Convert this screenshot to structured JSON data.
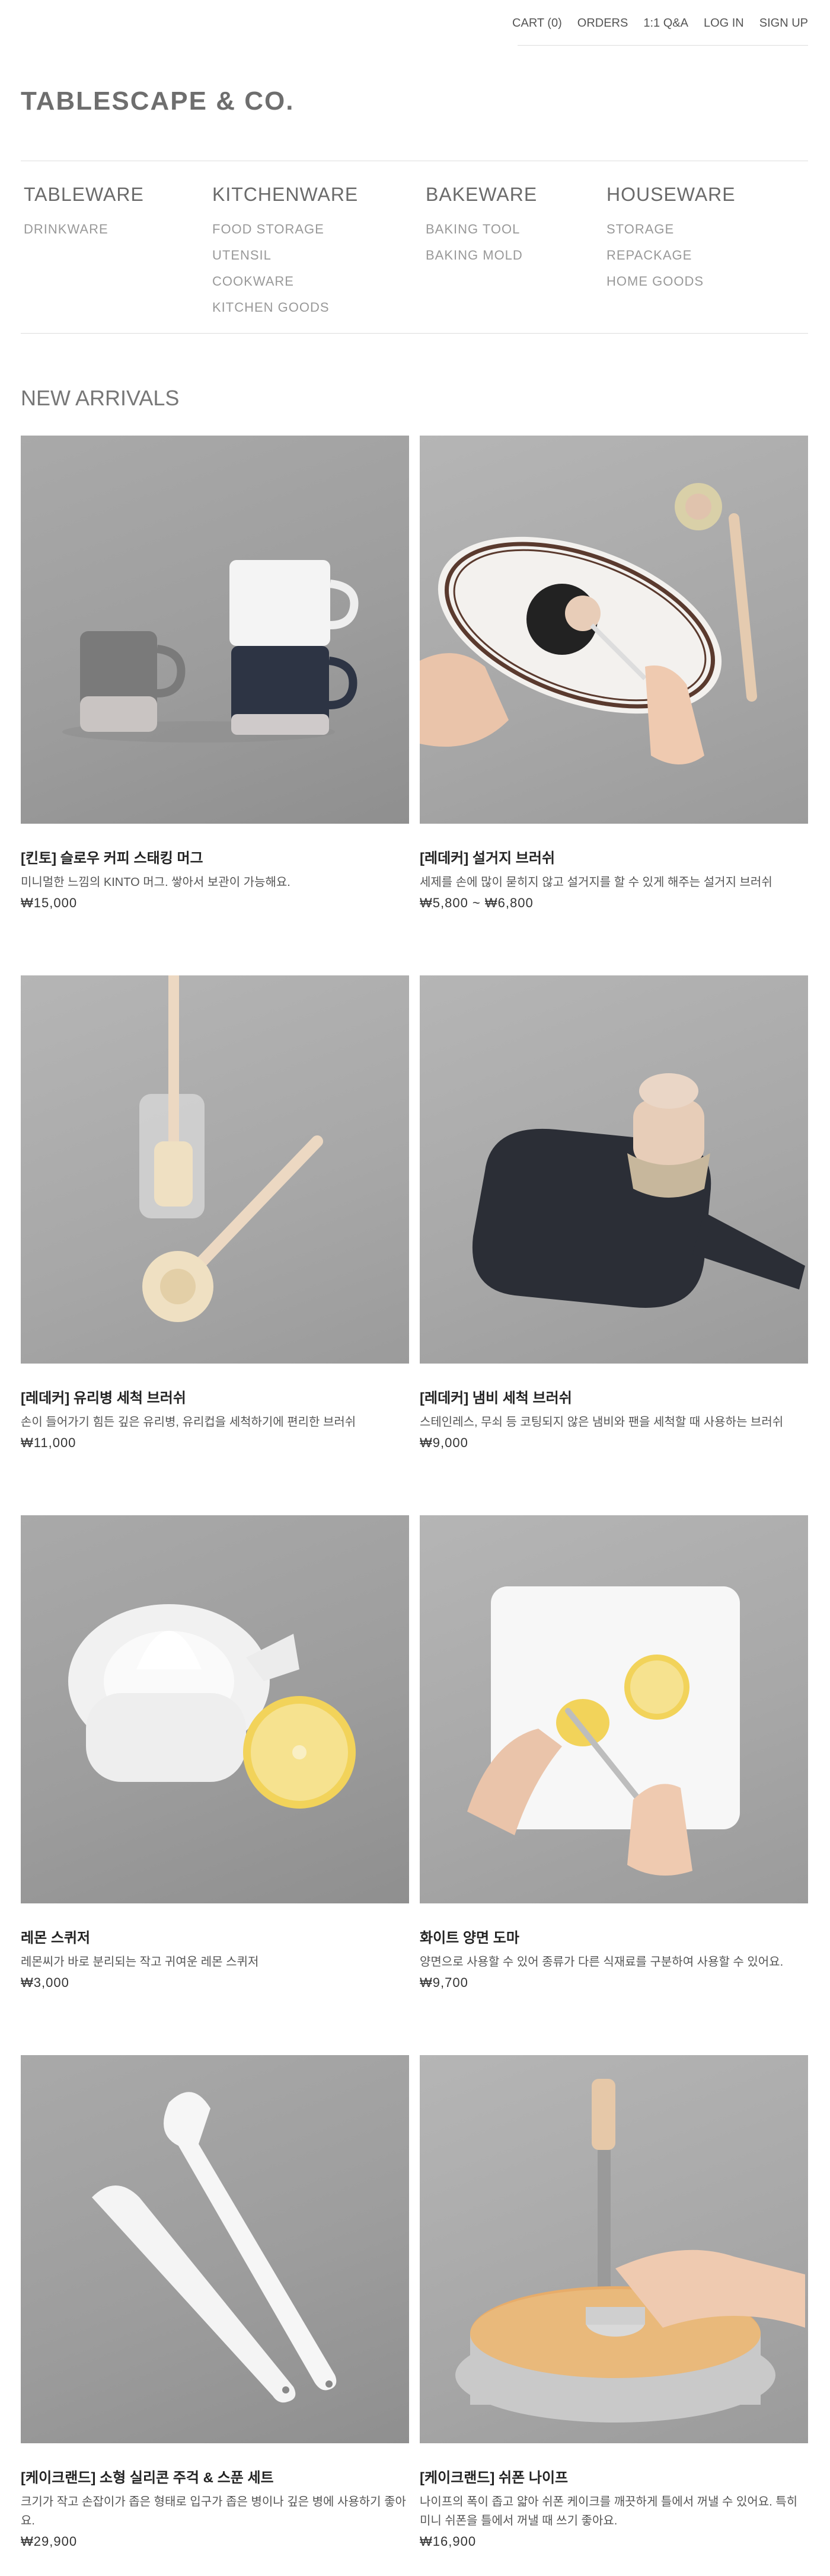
{
  "topnav": [
    "CART (0)",
    "ORDERS",
    "1:1 Q&A",
    "LOG IN",
    "SIGN UP"
  ],
  "logo": "TABLESCAPE & CO.",
  "categories": [
    {
      "title": "TABLEWARE",
      "items": [
        "DRINKWARE"
      ]
    },
    {
      "title": "KITCHENWARE",
      "items": [
        "FOOD STORAGE",
        "UTENSIL",
        "COOKWARE",
        "KITCHEN GOODS"
      ]
    },
    {
      "title": "BAKEWARE",
      "items": [
        "BAKING TOOL",
        "BAKING MOLD"
      ]
    },
    {
      "title": "HOUSEWARE",
      "items": [
        "STORAGE",
        "REPACKAGE",
        "HOME GOODS"
      ]
    }
  ],
  "section_title": "NEW ARRIVALS",
  "products": [
    {
      "name": "[킨토] 슬로우 커피 스태킹 머그",
      "desc": "미니멀한 느낌의 KINTO 머그. 쌓아서 보관이 가능해요.",
      "price": "₩15,000",
      "image": "stacking-mugs"
    },
    {
      "name": "[레데커] 설거지 브러쉬",
      "desc": "세제를 손에 많이 묻히지 않고 설거지를 할 수 있게 해주는 설거지 브러쉬",
      "price": "₩5,800 ~ ₩6,800",
      "image": "dish-brush"
    },
    {
      "name": "[레데커] 유리병 세척 브러쉬",
      "desc": "손이 들어가기 힘든 깊은 유리병, 유리컵을 세척하기에 편리한 브러쉬",
      "price": "₩11,000",
      "image": "bottle-brush"
    },
    {
      "name": "[레데커] 냄비 세척 브러쉬",
      "desc": "스테인레스, 무쇠 등 코팅되지 않은 냄비와 팬을 세척할 때 사용하는 브러쉬",
      "price": "₩9,000",
      "image": "pot-brush"
    },
    {
      "name": "레몬 스퀴저",
      "desc": "레몬씨가 바로 분리되는 작고 귀여운 레몬 스퀴저",
      "price": "₩3,000",
      "image": "lemon-squeezer"
    },
    {
      "name": "화이트 양면 도마",
      "desc": "양면으로 사용할 수 있어 종류가 다른 식재료를 구분하여 사용할 수 있어요.",
      "price": "₩9,700",
      "image": "cutting-board"
    },
    {
      "name": "[케이크랜드] 소형 실리콘 주걱 & 스푼 세트",
      "desc": "크기가 작고 손잡이가 좁은 형태로 입구가 좁은 병이나 깊은 병에 사용하기 좋아요.",
      "price": "₩29,900",
      "image": "silicone-spatula"
    },
    {
      "name": "[케이크랜드] 쉬폰 나이프",
      "desc": "나이프의 폭이 좁고 얇아 쉬폰 케이크를 깨끗하게 틀에서 꺼낼 수 있어요. 특히 미니 쉬폰을 틀에서 꺼낼 때 쓰기 좋아요.",
      "price": "₩16,900",
      "image": "chiffon-knife"
    }
  ]
}
